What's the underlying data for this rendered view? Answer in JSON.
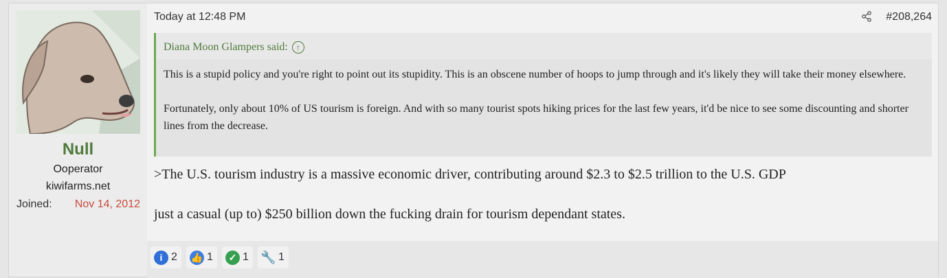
{
  "user": {
    "avatar_desc": "dog-avatar",
    "name": "Null",
    "title": "Ooperator",
    "site": "kiwifarms.net",
    "joined_label": "Joined:",
    "joined_date": "Nov 14, 2012"
  },
  "post": {
    "timestamp": "Today at 12:48 PM",
    "number": "#208,264",
    "quote": {
      "author_said": "Diana Moon Glampers said:",
      "paragraphs": [
        "This is a stupid policy and you're right to point out its stupidity. This is an obscene number of hoops to jump through and it's likely they will take their money elsewhere.",
        "Fortunately, only about 10% of US tourism is foreign. And with so many tourist spots hiking prices for the last few years, it'd be nice to see some discounting and shorter lines from the decrease."
      ]
    },
    "body": [
      ">The U.S. tourism industry is a massive economic driver, contributing around $2.3 to $2.5 trillion to the U.S. GDP",
      "just a casual (up to) $250 billion down the fucking drain for tourism dependant states."
    ]
  },
  "reactions": [
    {
      "icon": "informative-icon",
      "count": "2",
      "color": "#2f6fd6"
    },
    {
      "icon": "like-icon",
      "count": "1",
      "color": "#3d7fe0"
    },
    {
      "icon": "agree-icon",
      "count": "1",
      "color": "#37a050"
    },
    {
      "icon": "wrench-icon",
      "count": "1",
      "color": "#8a8a8a"
    }
  ]
}
